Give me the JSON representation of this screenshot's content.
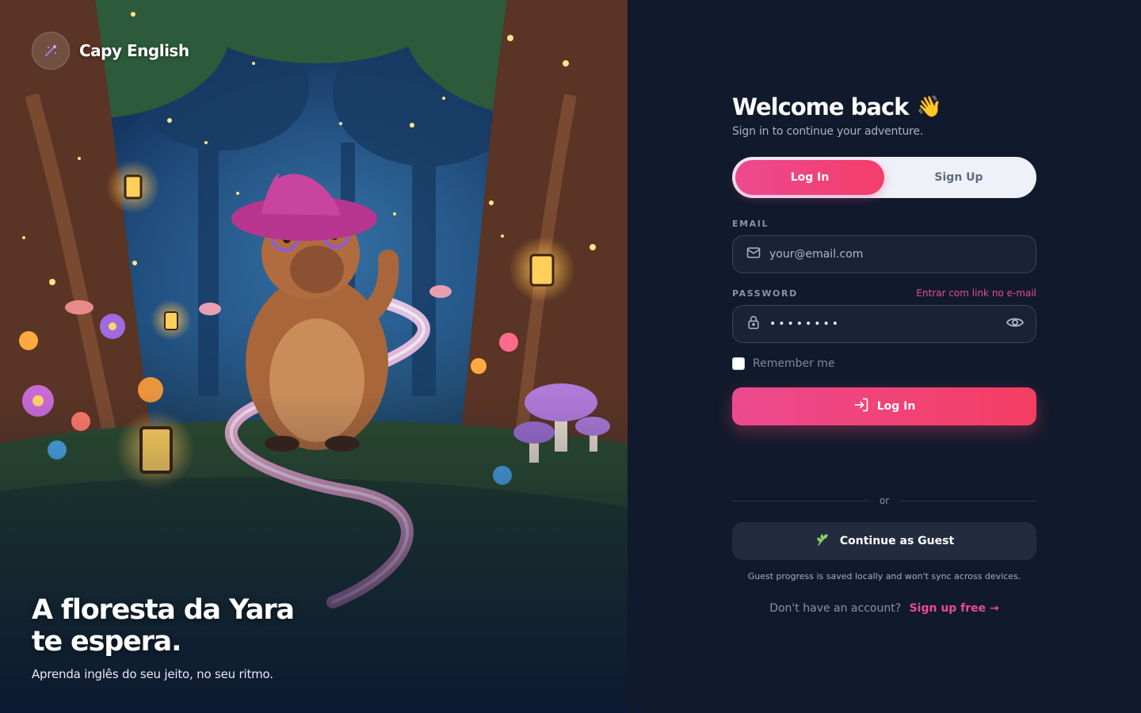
{
  "brand": {
    "name": "Capy English",
    "logo_icon": "sparkle-wand-icon"
  },
  "hero": {
    "title_line1": "A floresta da Yara",
    "title_line2": "te espera.",
    "subtitle": "Aprenda inglês do seu jeito, no seu ritmo."
  },
  "welcome": {
    "title": "Welcome back",
    "emoji": "👋",
    "subtitle": "Sign in to continue your adventure."
  },
  "tabs": [
    {
      "label": "Log In",
      "active": true
    },
    {
      "label": "Sign Up",
      "active": false
    }
  ],
  "email": {
    "label": "EMAIL",
    "placeholder": "your@email.com",
    "value": "",
    "icon": "mail-icon"
  },
  "password": {
    "label": "PASSWORD",
    "magic_link": "Entrar com link no e-mail",
    "value": "••••••••",
    "icon": "lock-icon",
    "toggle_icon": "eye-icon"
  },
  "remember": {
    "label": "Remember me",
    "checked": false
  },
  "login_button": {
    "label": "Log In",
    "icon": "login-arrow-icon"
  },
  "divider": {
    "text": "or"
  },
  "guest": {
    "label": "Continue as Guest",
    "icon": "sprout-icon",
    "note": "Guest progress is saved locally and won't sync across devices."
  },
  "signup": {
    "prompt": "Don't have an account?",
    "cta": "Sign up free →"
  },
  "colors": {
    "accent": "#ec4899",
    "accent_2": "#f43f5e",
    "panel_bg": "#111a2c",
    "input_bg": "#1a2336",
    "guest_bg": "#232c3f"
  }
}
